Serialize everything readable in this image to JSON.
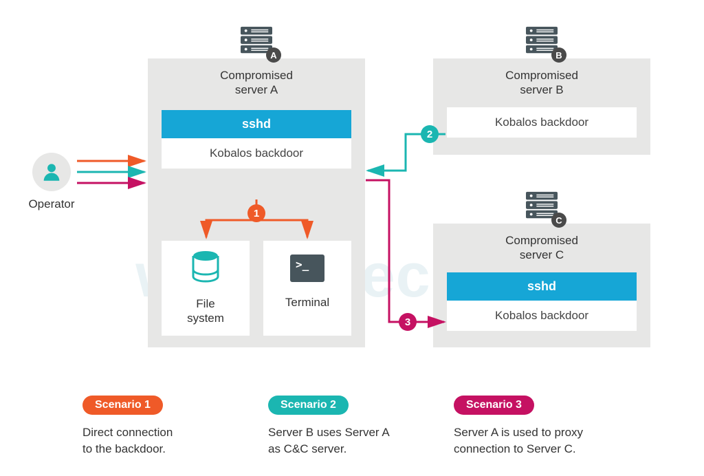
{
  "watermark": "welivesecurity",
  "operator": {
    "label": "Operator"
  },
  "serverA": {
    "title": "Compromised\nserver A",
    "letter": "A",
    "sshd": "sshd",
    "backdoor": "Kobalos backdoor",
    "fs": "File\nsystem",
    "terminal": "Terminal"
  },
  "serverB": {
    "title": "Compromised\nserver B",
    "letter": "B",
    "backdoor": "Kobalos backdoor"
  },
  "serverC": {
    "title": "Compromised\nserver C",
    "letter": "C",
    "sshd": "sshd",
    "backdoor": "Kobalos backdoor"
  },
  "badges": {
    "one": "1",
    "two": "2",
    "three": "3"
  },
  "scenarios": {
    "s1": {
      "pill": "Scenario 1",
      "desc": "Direct connection\nto the backdoor."
    },
    "s2": {
      "pill": "Scenario 2",
      "desc": "Server B uses Server A\nas C&C server."
    },
    "s3": {
      "pill": "Scenario 3",
      "desc": "Server A is used to proxy\nconnection to Server C."
    }
  }
}
